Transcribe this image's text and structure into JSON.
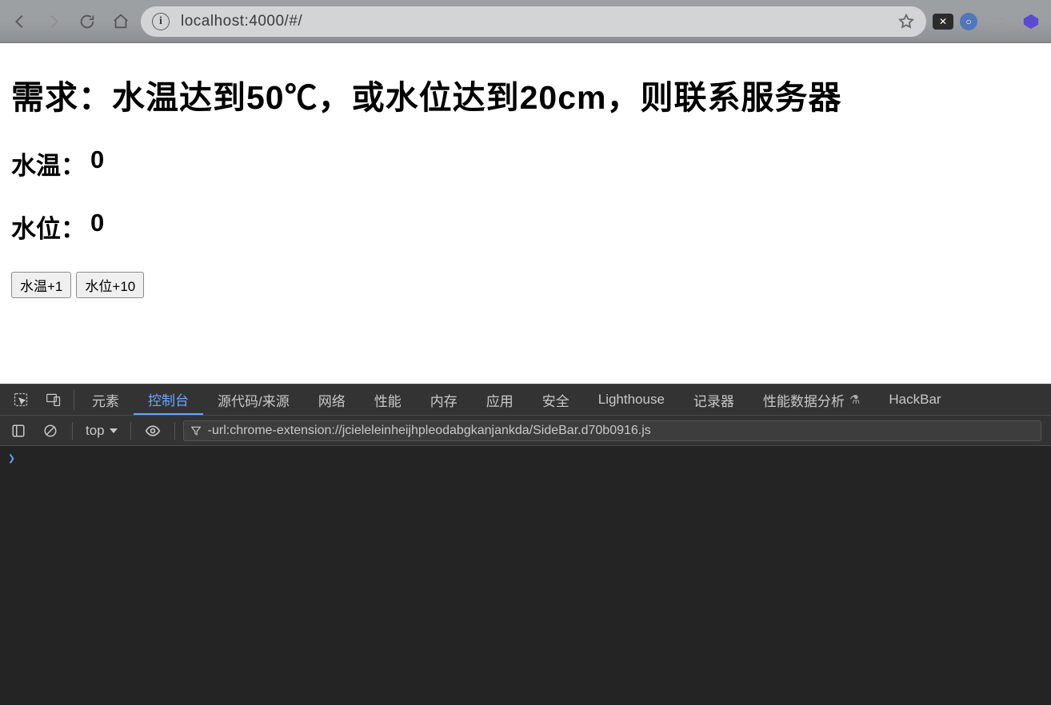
{
  "browser": {
    "url": "localhost:4000/#/"
  },
  "page": {
    "heading": "需求：水温达到50℃，或水位达到20cm，则联系服务器",
    "temp_label": "水温：",
    "temp_value": "0",
    "level_label": "水位：",
    "level_value": "0",
    "btn_temp": "水温+1",
    "btn_level": "水位+10"
  },
  "devtools": {
    "tabs": {
      "elements": "元素",
      "console": "控制台",
      "sources": "源代码/来源",
      "network": "网络",
      "performance": "性能",
      "memory": "内存",
      "application": "应用",
      "security": "安全",
      "lighthouse": "Lighthouse",
      "recorder": "记录器",
      "perf_insights": "性能数据分析",
      "hackbar": "HackBar"
    },
    "subbar": {
      "context": "top",
      "filter": "-url:chrome-extension://jcieleleinheijhpleodabgkanjankda/SideBar.d70b0916.js"
    },
    "prompt": "❯"
  }
}
